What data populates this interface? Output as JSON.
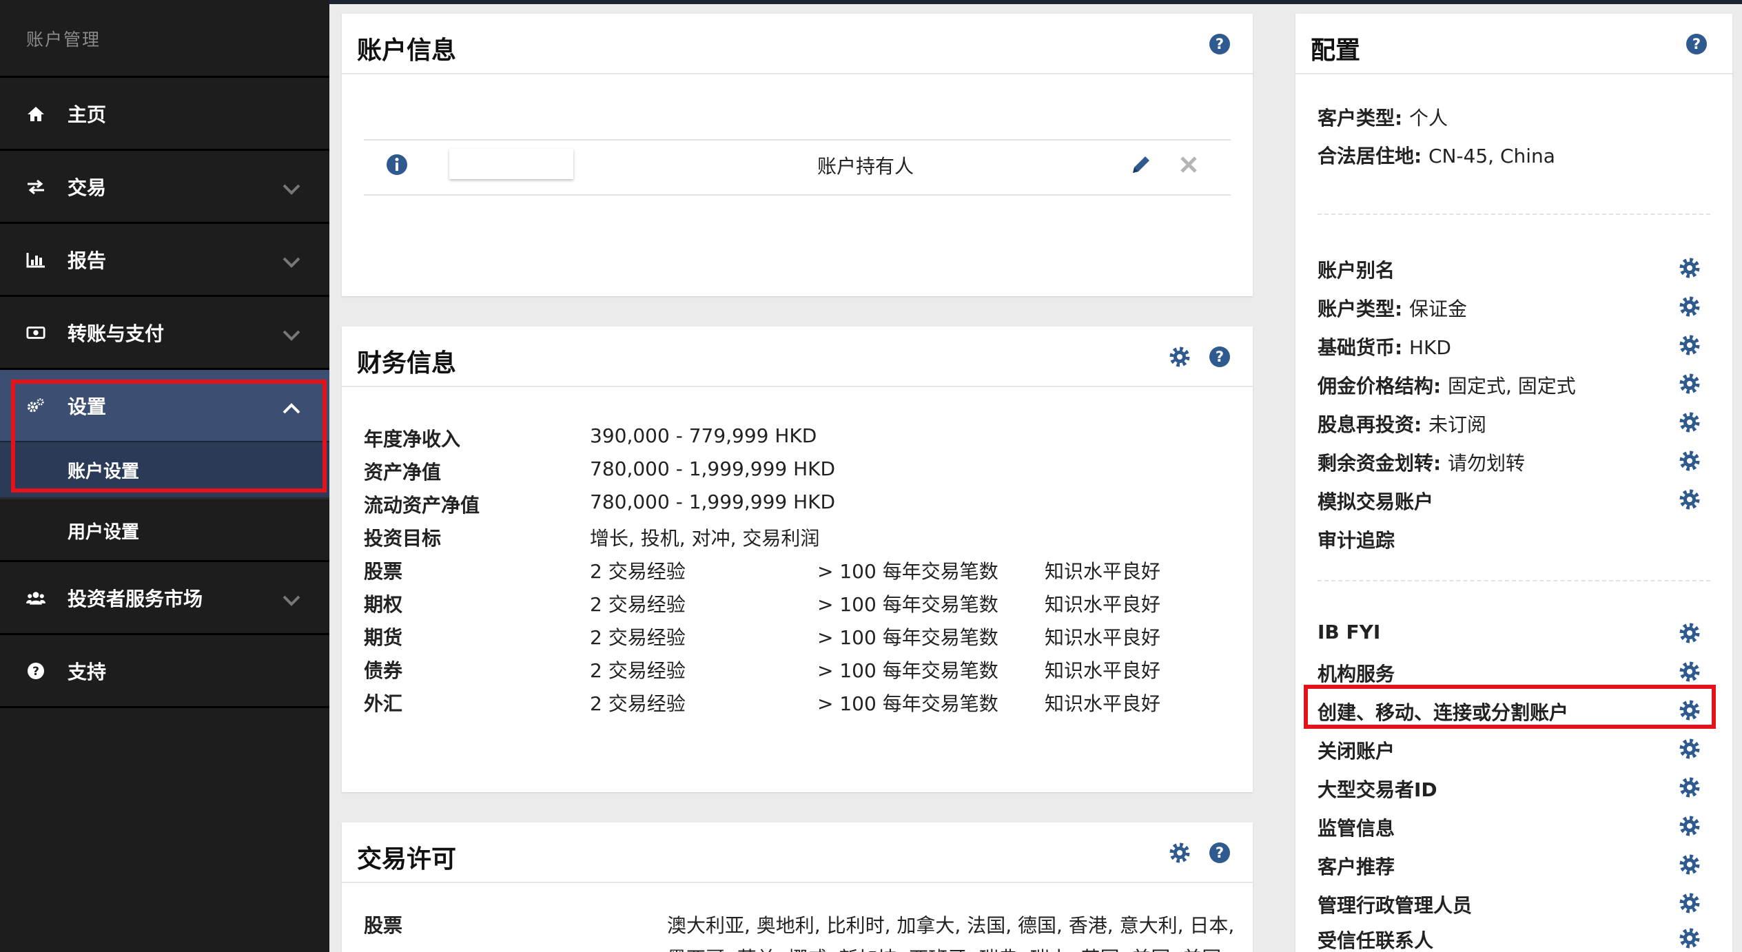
{
  "sidebar": {
    "title": "账户管理",
    "items": [
      {
        "label": "主页",
        "icon": "home-icon"
      },
      {
        "label": "交易",
        "icon": "transfer-arrows-icon"
      },
      {
        "label": "报告",
        "icon": "bar-chart-icon"
      },
      {
        "label": "转账与支付",
        "icon": "money-icon"
      },
      {
        "label": "设置",
        "icon": "gears-icon"
      },
      {
        "label": "投资者服务市场",
        "icon": "users-icon"
      },
      {
        "label": "支持",
        "icon": "question-icon"
      }
    ],
    "settings_sub": {
      "account_settings": "账户设置",
      "user_settings": "用户设置"
    }
  },
  "account_info": {
    "title": "账户信息",
    "holder_role": "账户持有人"
  },
  "financial": {
    "title": "财务信息",
    "rows": [
      {
        "label": "年度净收入",
        "value": "390,000 - 779,999 HKD"
      },
      {
        "label": "资产净值",
        "value": "780,000 - 1,999,999 HKD"
      },
      {
        "label": "流动资产净值",
        "value": "780,000 - 1,999,999 HKD"
      },
      {
        "label": "投资目标",
        "value": "增长, 投机, 对冲, 交易利润"
      }
    ],
    "experience": [
      {
        "label": "股票",
        "years": "2 交易经验",
        "trades": "> 100 每年交易笔数",
        "knowledge": "知识水平良好"
      },
      {
        "label": "期权",
        "years": "2 交易经验",
        "trades": "> 100 每年交易笔数",
        "knowledge": "知识水平良好"
      },
      {
        "label": "期货",
        "years": "2 交易经验",
        "trades": "> 100 每年交易笔数",
        "knowledge": "知识水平良好"
      },
      {
        "label": "债券",
        "years": "2 交易经验",
        "trades": "> 100 每年交易笔数",
        "knowledge": "知识水平良好"
      },
      {
        "label": "外汇",
        "years": "2 交易经验",
        "trades": "> 100 每年交易笔数",
        "knowledge": "知识水平良好"
      }
    ]
  },
  "trading_permissions": {
    "title": "交易许可",
    "rows": [
      {
        "label": "股票",
        "value": "澳大利亚, 奥地利, 比利时, 加拿大, 法国, 德国, 香港, 意大利, 日本,",
        "value2": "墨西哥, 荷兰, 挪威, 新加坡, 西班牙, 瑞典, 瑞士, 英国, 美国, 美国"
      }
    ]
  },
  "config": {
    "title": "配置",
    "client_type": {
      "label": "客户类型:",
      "value": "个人"
    },
    "residence": {
      "label": "合法居住地:",
      "value": "CN-45, China"
    },
    "group1": [
      {
        "label": "账户别名",
        "value": ""
      },
      {
        "label": "账户类型:",
        "value": "保证金"
      },
      {
        "label": "基础货币:",
        "value": "HKD"
      },
      {
        "label": "佣金价格结构:",
        "value": "固定式, 固定式"
      },
      {
        "label": "股息再投资:",
        "value": "未订阅"
      },
      {
        "label": "剩余资金划转:",
        "value": "请勿划转"
      },
      {
        "label": "模拟交易账户",
        "value": ""
      },
      {
        "label": "审计追踪",
        "value": ""
      }
    ],
    "group2": [
      {
        "label": "IB FYI"
      },
      {
        "label": "机构服务"
      },
      {
        "label": "创建、移动、连接或分割账户"
      },
      {
        "label": "关闭账户"
      },
      {
        "label": "大型交易者ID"
      },
      {
        "label": "监管信息"
      },
      {
        "label": "客户推荐"
      },
      {
        "label": "管理行政管理人员"
      },
      {
        "label": "受信任联系人"
      }
    ]
  },
  "colors": {
    "sidebar_bg": "#1d1d1d",
    "active_bg": "#3c4f73",
    "icon_blue": "#2f5a8f",
    "highlight_red": "#e3131b"
  }
}
